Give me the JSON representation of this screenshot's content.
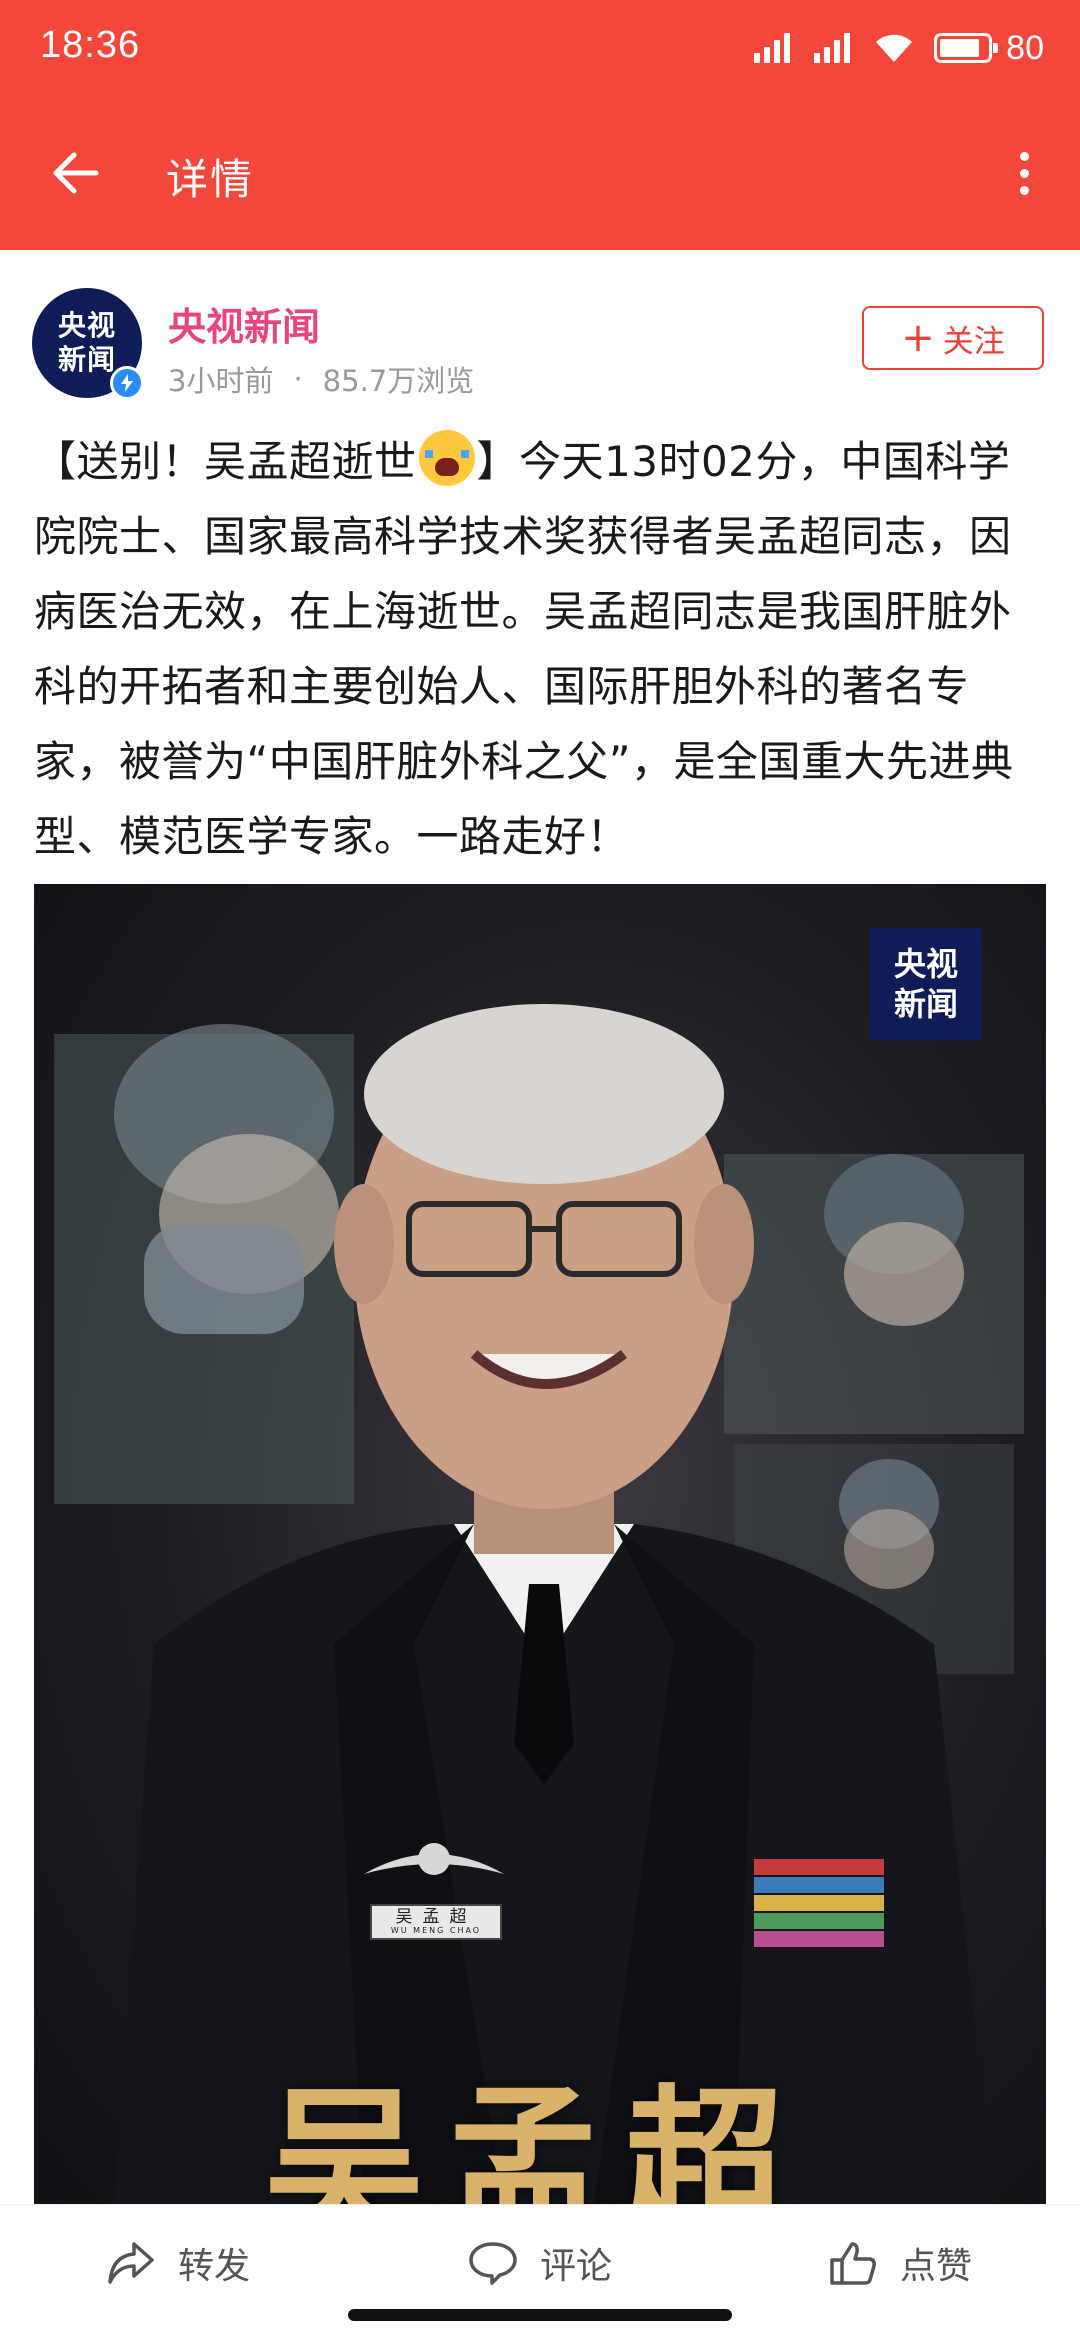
{
  "status_bar": {
    "time": "18:36",
    "battery": "80",
    "icons": [
      "signal-icon",
      "signal-icon",
      "wifi-icon",
      "battery-icon"
    ]
  },
  "app_bar": {
    "title": "详情",
    "back_icon": "arrow-left-icon",
    "more_icon": "more-vertical-icon"
  },
  "publisher": {
    "avatar_line1": "央视",
    "avatar_line2": "新闻",
    "name": "央视新闻",
    "time_ago": "3小时前",
    "separator": "·",
    "views": "85.7万浏览",
    "follow_label": "关注",
    "follow_icon": "plus-icon",
    "verified_icon": "lightning-icon",
    "name_color": "#e8467b"
  },
  "article": {
    "prefix": "【送别！吴孟超逝世",
    "emoji": "sob-emoji",
    "body": "】今天13时02分，中国科学院院士、国家最高科学技术奖获得者吴孟超同志，因病医治无效，在上海逝世。吴孟超同志是我国肝脏外科的开拓者和主要创始人、国际肝胆外科的著名专家，被誉为“中国肝脏外科之父”，是全国重大先进典型、模范医学专家。一路走好！"
  },
  "photo": {
    "watermark_line1": "央视",
    "watermark_line2": "新闻",
    "caption": "吴孟超",
    "badge_name": "吴孟超",
    "badge_pinyin": "WU MENG CHAO"
  },
  "bottom_bar": {
    "share_label": "转发",
    "comment_label": "评论",
    "like_label": "点赞"
  },
  "colors": {
    "header": "#f4473c",
    "accent": "#e8433a",
    "brand_navy": "#0e1d57",
    "brand_gold": "#d6a659"
  }
}
